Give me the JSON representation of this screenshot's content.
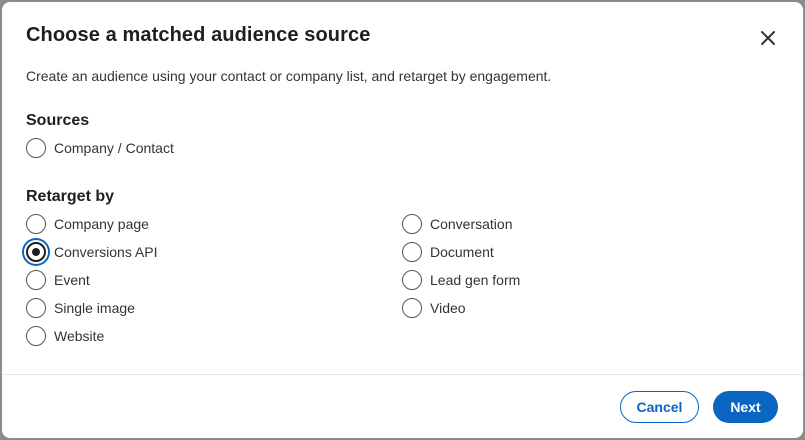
{
  "dialog": {
    "title": "Choose a matched audience source",
    "close_icon": "close-icon",
    "description": "Create an audience using your contact or company list, and retarget by engagement."
  },
  "sources": {
    "heading": "Sources",
    "options": [
      {
        "label": "Company / Contact",
        "checked": false
      }
    ]
  },
  "retarget": {
    "heading": "Retarget by",
    "left_column": [
      {
        "label": "Company page",
        "checked": false
      },
      {
        "label": "Conversions API",
        "checked": true
      },
      {
        "label": "Event",
        "checked": false
      },
      {
        "label": "Single image",
        "checked": false
      },
      {
        "label": "Website",
        "checked": false
      }
    ],
    "right_column": [
      {
        "label": "Conversation",
        "checked": false
      },
      {
        "label": "Document",
        "checked": false
      },
      {
        "label": "Lead gen form",
        "checked": false
      },
      {
        "label": "Video",
        "checked": false
      }
    ]
  },
  "footer": {
    "cancel_label": "Cancel",
    "next_label": "Next"
  },
  "colors": {
    "accent": "#0a66c2",
    "text_primary": "#1f1f1f",
    "text_secondary": "#333333",
    "overlay": "#8c8c8c"
  }
}
